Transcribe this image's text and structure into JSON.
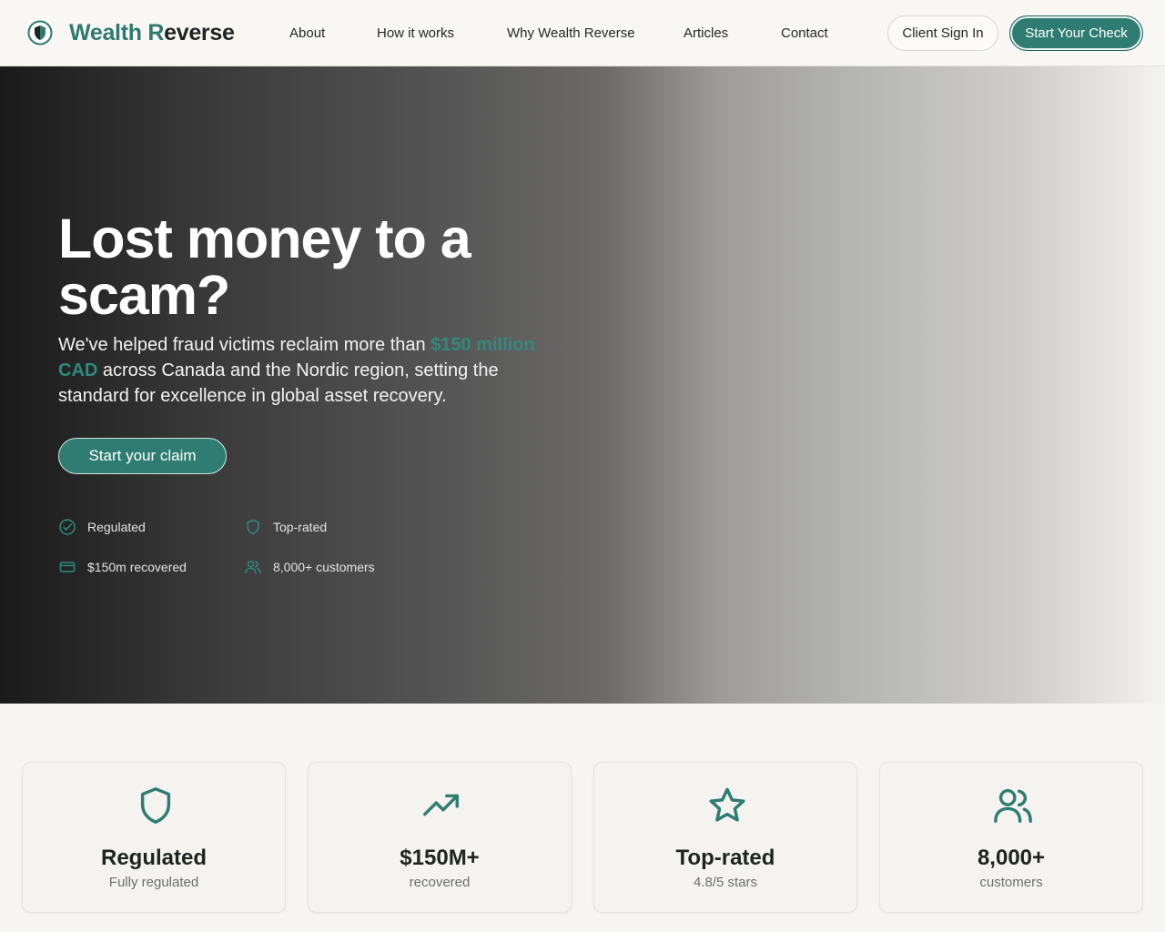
{
  "brand": {
    "name_part1": "Wealth ",
    "name_part2": "R",
    "name_part3": "everse",
    "accent": "#2d7a6f"
  },
  "nav": {
    "items": [
      {
        "label": "About"
      },
      {
        "label": "How it works"
      },
      {
        "label": "Why Wealth Reverse"
      },
      {
        "label": "Articles"
      },
      {
        "label": "Contact"
      }
    ],
    "signin_label": "Client Sign In",
    "start_label": "Start Your Check"
  },
  "hero": {
    "title": "Lost money to a scam?",
    "sub_before": "We've helped fraud victims reclaim more than ",
    "sub_highlight": "$150 million CAD",
    "sub_after": " across Canada and the Nordic region, setting the standard for excellence in global asset recovery.",
    "cta_label": "Start your claim",
    "features": [
      {
        "icon": "check-circle-icon",
        "label": "Regulated"
      },
      {
        "icon": "shield-icon",
        "label": "Top-rated"
      },
      {
        "icon": "credit-card-icon",
        "label": "$150m recovered"
      },
      {
        "icon": "users-icon",
        "label": "8,000+ customers"
      }
    ]
  },
  "stats": [
    {
      "icon": "shield-icon",
      "title": "Regulated",
      "sub": "Fully regulated"
    },
    {
      "icon": "trending-up-icon",
      "title": "$150M+",
      "sub": "recovered"
    },
    {
      "icon": "star-icon",
      "title": "Top-rated",
      "sub": "4.8/5 stars"
    },
    {
      "icon": "users-icon",
      "title": "8,000+",
      "sub": "customers"
    }
  ],
  "colors": {
    "primary": "#2f7d72",
    "highlight": "#2f8a7e",
    "page_bg": "#f6f5f2"
  }
}
